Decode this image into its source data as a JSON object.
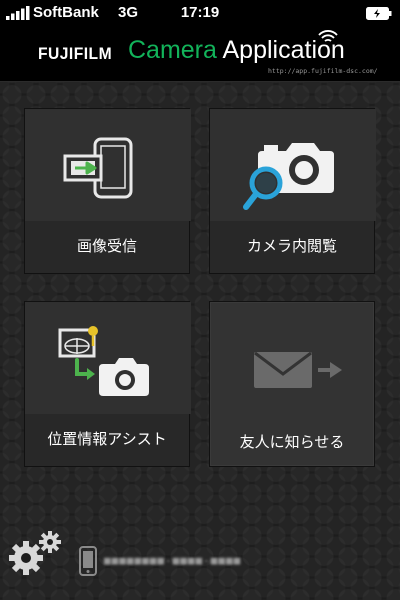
{
  "status_bar": {
    "carrier": "SoftBank",
    "network": "3G",
    "time": "17:19"
  },
  "header": {
    "brand": "FUJIFILM",
    "title_camera": "Camera",
    "title_app": "Application",
    "url": "http://app.fujifilm-dsc.com/"
  },
  "tiles": [
    {
      "label": "画像受信",
      "icon": "phone-receive-icon"
    },
    {
      "label": "カメラ内閲覧",
      "icon": "camera-magnifier-icon"
    },
    {
      "label": "位置情報アシスト",
      "icon": "location-camera-icon"
    },
    {
      "label": "友人に知らせる",
      "icon": "mail-arrow-icon"
    }
  ],
  "footer": {
    "device_id": "■■■■■■■■-■■■■-■■■■"
  },
  "colors": {
    "brand_green": "#12b35a",
    "tile_bg": "#333333",
    "tile_label_bg": "#282828",
    "icon_green": "#4db34d",
    "icon_blue": "#2aa3d9"
  }
}
